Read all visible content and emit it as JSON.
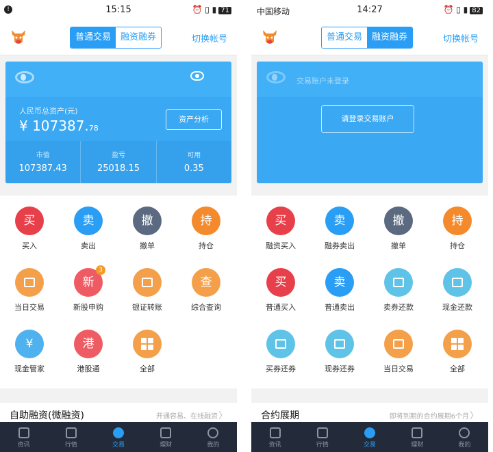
{
  "left": {
    "status": {
      "time": "15:15",
      "battery": "71"
    },
    "header": {
      "tabs": [
        "普通交易",
        "融资融券"
      ],
      "active_tab": 0,
      "switch_account": "切换帐号"
    },
    "account": {
      "total_asset_label": "人民币总资产(元)",
      "total_asset_main": "¥ 107387.",
      "total_asset_decimal": "78",
      "analysis_button": "资产分析",
      "stats": [
        {
          "label": "市值",
          "value": "107387.43"
        },
        {
          "label": "盈亏",
          "value": "25018.15"
        },
        {
          "label": "可用",
          "value": "0.35"
        }
      ]
    },
    "grid": [
      {
        "label": "买入",
        "glyph": "买",
        "color": "#e8404a"
      },
      {
        "label": "卖出",
        "glyph": "卖",
        "color": "#2a9df4"
      },
      {
        "label": "撤单",
        "glyph": "撤",
        "color": "#5b6a80"
      },
      {
        "label": "持仓",
        "glyph": "持",
        "color": "#f48a2c"
      },
      {
        "label": "当日交易",
        "glyph": "",
        "color": "#f4a04a"
      },
      {
        "label": "新股申购",
        "glyph": "新",
        "color": "#ef5b63",
        "badge": "3"
      },
      {
        "label": "银证转账",
        "glyph": "",
        "color": "#f4a04a"
      },
      {
        "label": "综合查询",
        "glyph": "查",
        "color": "#f4a04a"
      },
      {
        "label": "现金管家",
        "glyph": "¥",
        "color": "#4fb2ef"
      },
      {
        "label": "港股通",
        "glyph": "港",
        "color": "#ef5b63"
      },
      {
        "label": "全部",
        "glyph": "",
        "color": "#f4a04a"
      }
    ],
    "promo": {
      "title": "自助融资(微融资)",
      "subtitle": "开通容易、在线融资"
    },
    "tabbar": [
      "资讯",
      "行情",
      "交易",
      "理财",
      "我的"
    ],
    "active_tab": 2
  },
  "right": {
    "status": {
      "carrier": "中国移动",
      "time": "14:27",
      "battery": "82"
    },
    "header": {
      "tabs": [
        "普通交易",
        "融资融券"
      ],
      "active_tab": 1,
      "switch_account": "切换帐号"
    },
    "account": {
      "hint": "交易账户未登录",
      "login_button": "请登录交易账户"
    },
    "grid": [
      {
        "label": "融资买入",
        "glyph": "买",
        "color": "#e8404a"
      },
      {
        "label": "融券卖出",
        "glyph": "卖",
        "color": "#2a9df4"
      },
      {
        "label": "撤单",
        "glyph": "撤",
        "color": "#5b6a80"
      },
      {
        "label": "持仓",
        "glyph": "持",
        "color": "#f48a2c"
      },
      {
        "label": "普通买入",
        "glyph": "买",
        "color": "#e8404a"
      },
      {
        "label": "普通卖出",
        "glyph": "卖",
        "color": "#2a9df4"
      },
      {
        "label": "卖券还款",
        "glyph": "",
        "color": "#5fc3e8"
      },
      {
        "label": "现金还款",
        "glyph": "",
        "color": "#5fc3e8"
      },
      {
        "label": "买券还券",
        "glyph": "",
        "color": "#5fc3e8"
      },
      {
        "label": "现券还券",
        "glyph": "",
        "color": "#5fc3e8"
      },
      {
        "label": "当日交易",
        "glyph": "",
        "color": "#f4a04a"
      },
      {
        "label": "全部",
        "glyph": "",
        "color": "#f4a04a"
      }
    ],
    "promo": {
      "title": "合约展期",
      "subtitle": "即将到期的合约展期6个月"
    },
    "tabbar": [
      "资讯",
      "行情",
      "交易",
      "理财",
      "我的"
    ],
    "active_tab": 2
  }
}
